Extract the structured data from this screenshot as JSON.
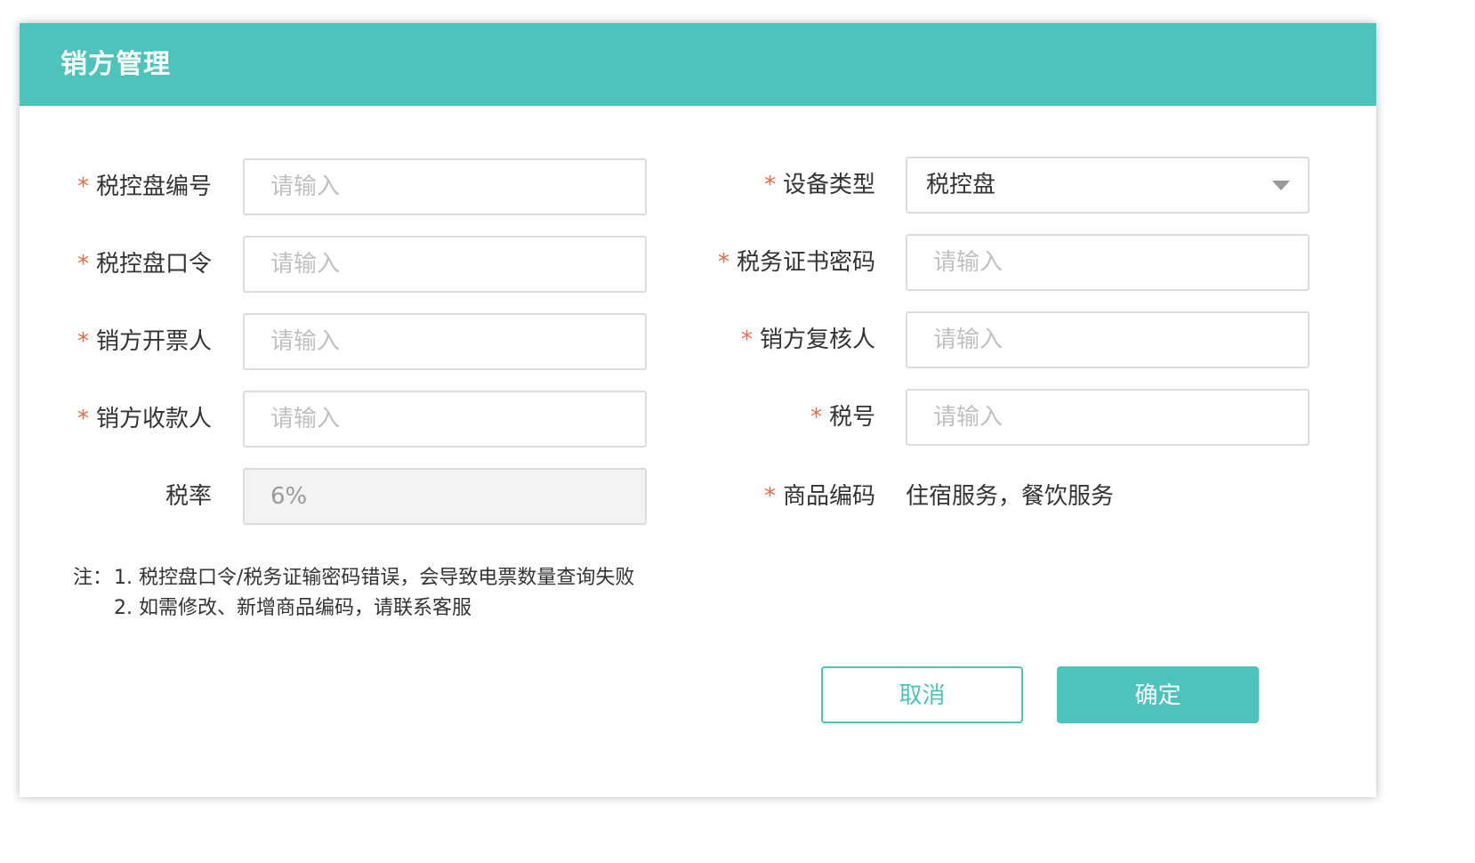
{
  "dialog": {
    "title": "销方管理"
  },
  "form": {
    "required_mark": "*",
    "left": [
      {
        "label": "税控盘编号",
        "required": true,
        "placeholder": "请输入",
        "value": ""
      },
      {
        "label": "税控盘口令",
        "required": true,
        "placeholder": "请输入",
        "value": ""
      },
      {
        "label": "销方开票人",
        "required": true,
        "placeholder": "请输入",
        "value": ""
      },
      {
        "label": "销方收款人",
        "required": true,
        "placeholder": "请输入",
        "value": ""
      },
      {
        "label": "税率",
        "required": false,
        "placeholder": "",
        "value": "6%",
        "disabled": true
      }
    ],
    "right": [
      {
        "label": "设备类型",
        "required": true,
        "type": "select",
        "value": "税控盘"
      },
      {
        "label": "税务证书密码",
        "required": true,
        "placeholder": "请输入",
        "value": ""
      },
      {
        "label": "销方复核人",
        "required": true,
        "placeholder": "请输入",
        "value": ""
      },
      {
        "label": "税号",
        "required": true,
        "placeholder": "请输入",
        "value": ""
      },
      {
        "label": "商品编码",
        "required": true,
        "type": "text",
        "value": "住宿服务，餐饮服务"
      }
    ]
  },
  "notes": {
    "prefix": "注：",
    "lines": [
      "1. 税控盘口令/税务证输密码错误，会导致电票数量查询失败",
      "2. 如需修改、新增商品编码，请联系客服"
    ]
  },
  "buttons": {
    "cancel": "取消",
    "ok": "确定"
  },
  "colors": {
    "accent": "#4cc4bb",
    "required": "#ee6a40",
    "border": "#dcdcdc",
    "placeholder": "#c0c0c0",
    "disabled_bg": "#f3f3f3"
  },
  "icons": {
    "select_arrow": "caret-down-icon"
  }
}
